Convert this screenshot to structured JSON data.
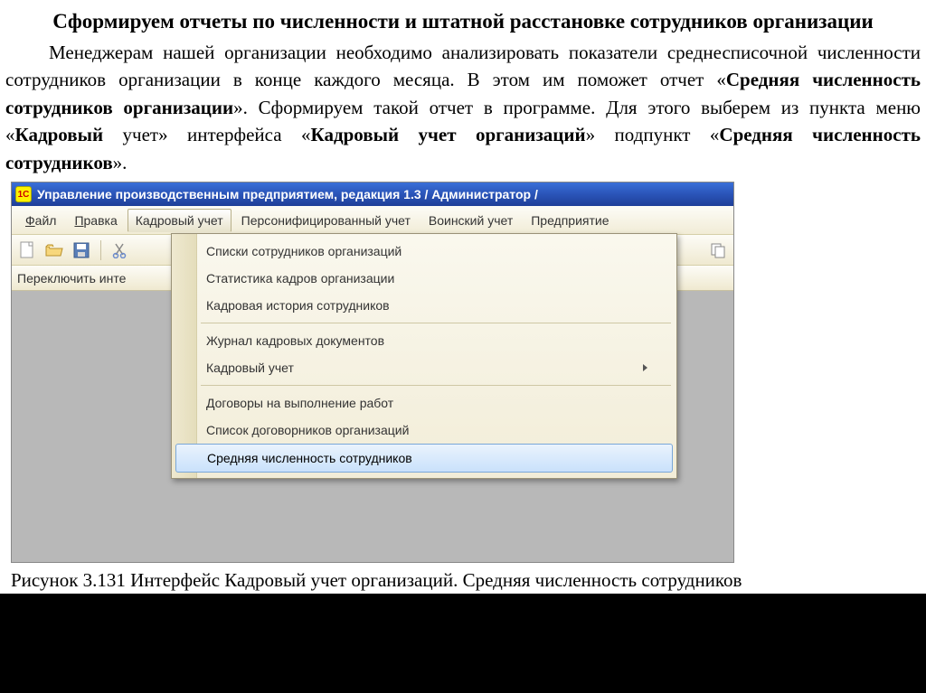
{
  "doc": {
    "title": "Сформируем отчеты по численности и штатной расстановке сотрудников организации",
    "body_prefix": "Менеджерам нашей организации необходимо анализировать показатели среднесписочной численности сотрудников организации в конце каждого месяца. В этом им поможет отчет «",
    "body_b1": "Средняя численность сотрудников организации",
    "body_mid1": "». Сформируем такой отчет в программе. Для этого выберем из пункта меню «",
    "body_b2": "Кадровый",
    "body_mid2": " учет» интерфейса «",
    "body_b3": "Кадровый учет организаций",
    "body_mid3": "» подпункт «",
    "body_b4": "Средняя численность сотрудников",
    "body_suffix": "».",
    "caption": "Рисунок 3.131 Интерфейс Кадровый учет организаций. Средняя численность сотрудников"
  },
  "app": {
    "icon_text": "1C",
    "title": "Управление производственным предприятием, редакция 1.3 / Администратор /",
    "menus": {
      "file_u": "Ф",
      "file_rest": "айл",
      "edit_u": "П",
      "edit_rest": "равка",
      "hr": "Кадровый учет",
      "pers": "Персонифицированный учет",
      "mil": "Воинский учет",
      "ent": "Предприятие"
    },
    "switch_label": "Переключить инте",
    "dropdown": {
      "i0": "Списки сотрудников организаций",
      "i1": "Статистика кадров организации",
      "i2": "Кадровая история сотрудников",
      "i3": "Журнал кадровых документов",
      "i4": "Кадровый учет",
      "i5": "Договоры на выполнение работ",
      "i6": "Список договорников организаций",
      "i7": "Средняя численность сотрудников"
    }
  }
}
